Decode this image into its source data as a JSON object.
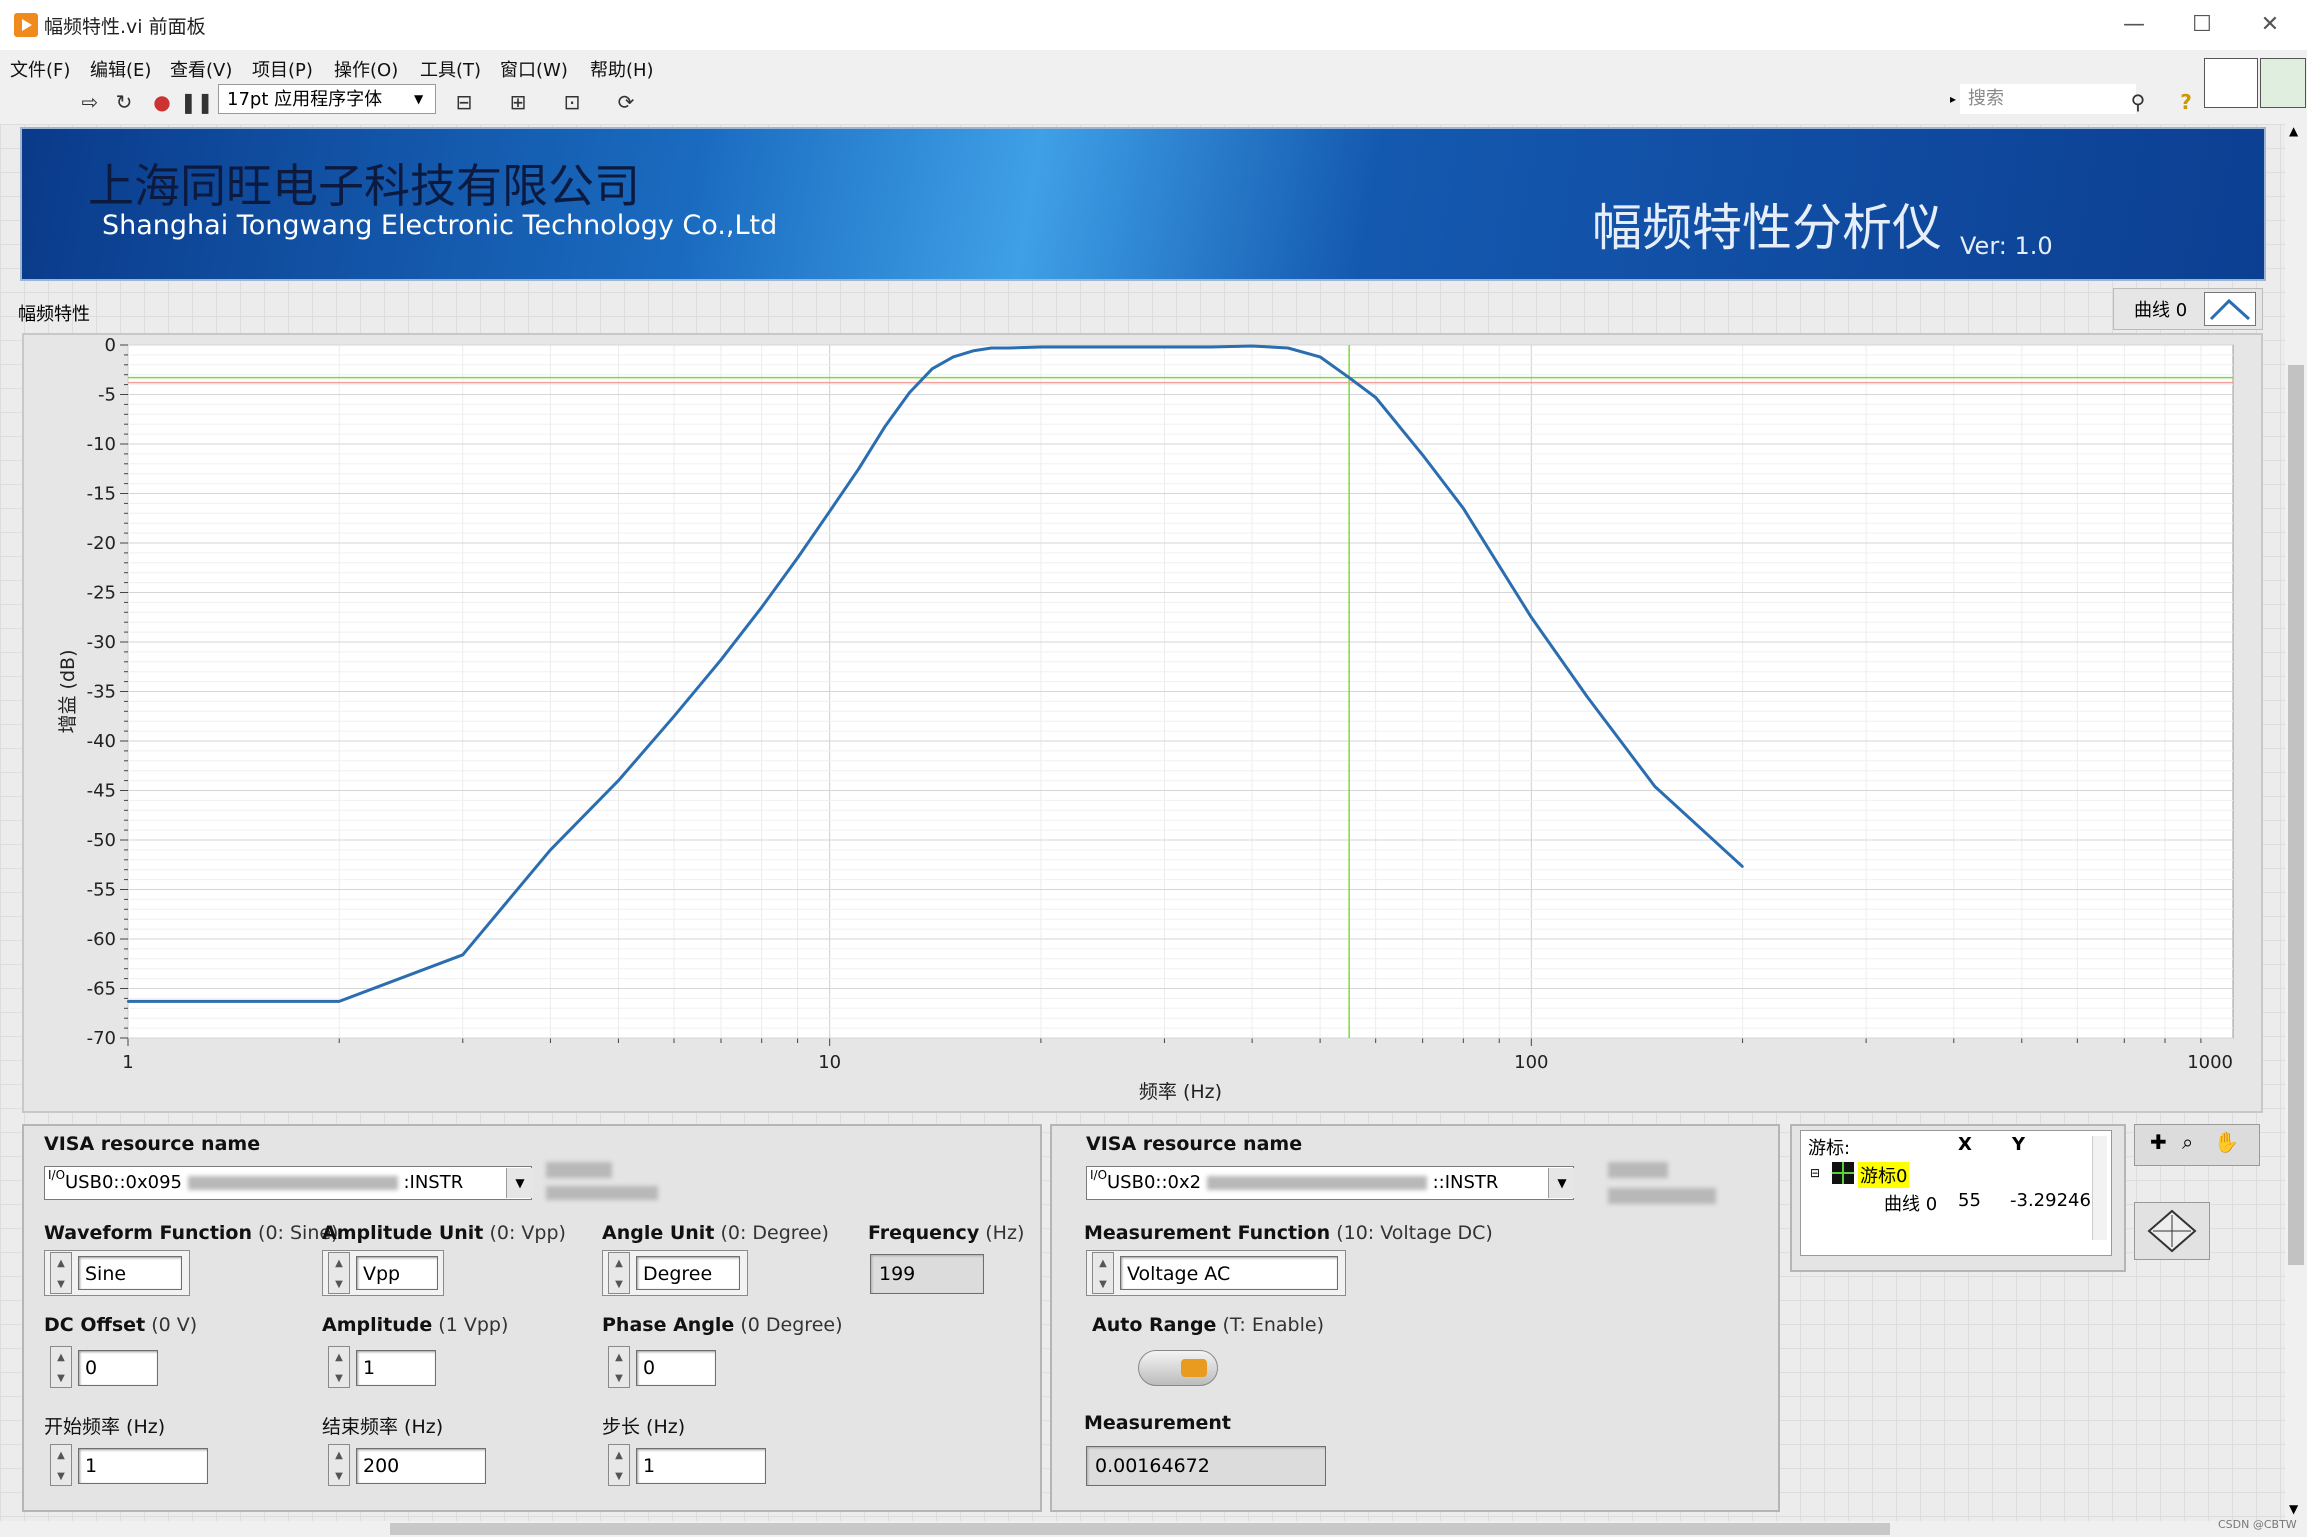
{
  "window": {
    "title": "幅频特性.vi 前面板",
    "minimize": "—",
    "maximize": "☐",
    "close": "✕"
  },
  "menu": [
    "文件(F)",
    "编辑(E)",
    "查看(V)",
    "项目(P)",
    "操作(O)",
    "工具(T)",
    "窗口(W)",
    "帮助(H)"
  ],
  "toolbar": {
    "font": "17pt 应用程序字体",
    "search_placeholder": "搜索"
  },
  "banner": {
    "company_cn": "上海同旺电子科技有限公司",
    "company_en": "Shanghai Tongwang Electronic Technology Co.,Ltd",
    "app_title": "幅频特性分析仪",
    "version": "Ver:  1.0"
  },
  "graph": {
    "label": "幅频特性",
    "legend": "曲线 0",
    "x_label": "频率 (Hz)",
    "y_label": "增益 (dB)",
    "x_ticks": [
      "1",
      "10",
      "100",
      "1000"
    ],
    "y_ticks": [
      "0",
      "-5",
      "-10",
      "-15",
      "-20",
      "-25",
      "-30",
      "-35",
      "-40",
      "-45",
      "-50",
      "-55",
      "-60",
      "-65",
      "-70"
    ],
    "colors": {
      "curve": "#2a6db0",
      "cursor": "#7bdc3a",
      "ref_line": "#f2a0a0"
    }
  },
  "chart_data": {
    "type": "line",
    "title": "幅频特性",
    "xlabel": "频率 (Hz)",
    "ylabel": "增益 (dB)",
    "xscale": "log",
    "xlim": [
      1,
      1000
    ],
    "ylim": [
      -70,
      0
    ],
    "grid": true,
    "series": [
      {
        "name": "曲线 0",
        "x": [
          1,
          2,
          3,
          4,
          5,
          6,
          7,
          8,
          9,
          10,
          11,
          12,
          13,
          14,
          15,
          16,
          17,
          18,
          20,
          25,
          30,
          35,
          40,
          45,
          50,
          55,
          60,
          70,
          80,
          100,
          120,
          150,
          200
        ],
        "y": [
          -66.3,
          -66.3,
          -61.6,
          -51.0,
          -44.0,
          -37.5,
          -31.8,
          -26.5,
          -21.5,
          -16.8,
          -12.5,
          -8.2,
          -4.8,
          -2.4,
          -1.2,
          -0.6,
          -0.3,
          -0.3,
          -0.2,
          -0.2,
          -0.2,
          -0.2,
          -0.1,
          -0.3,
          -1.2,
          -3.3,
          -5.3,
          -11.1,
          -16.5,
          -27.5,
          -35.5,
          -44.6,
          -52.7
        ]
      }
    ],
    "cursor": {
      "x": 55,
      "y": -3.29
    }
  },
  "gen": {
    "visa_label": "VISA resource name",
    "visa_value_start": "USB0::0x095",
    "visa_value_end": ":INSTR",
    "waveform_label": "Waveform Function",
    "waveform_hint": "(0: Sine)",
    "waveform_value": "Sine",
    "amp_unit_label": "Amplitude Unit",
    "amp_unit_hint": "(0: Vpp)",
    "amp_unit_value": "Vpp",
    "angle_unit_label": "Angle Unit",
    "angle_unit_hint": "(0: Degree)",
    "angle_unit_value": "Degree",
    "freq_label": "Frequency",
    "freq_hint": "(Hz)",
    "freq_value": "199",
    "dc_label": "DC Offset",
    "dc_hint": "(0 V)",
    "dc_value": "0",
    "amp_label": "Amplitude",
    "amp_hint": "(1 Vpp)",
    "amp_value": "1",
    "phase_label": "Phase Angle",
    "phase_hint": "(0 Degree)",
    "phase_value": "0",
    "start_label": "开始频率 (Hz)",
    "start_value": "1",
    "end_label": "结束频率 (Hz)",
    "end_value": "200",
    "step_label": "步长 (Hz)",
    "step_value": "1"
  },
  "meter": {
    "visa_label": "VISA resource name",
    "visa_value_start": "USB0::0x2",
    "visa_value_end": "::INSTR",
    "func_label": "Measurement Function",
    "func_hint": "(10: Voltage DC)",
    "func_value": "Voltage AC",
    "autorange_label": "Auto Range",
    "autorange_hint": "(T: Enable)",
    "measurement_label": "Measurement",
    "measurement_value": "0.00164672"
  },
  "cursor_legend": {
    "title": "游标:",
    "col_x": "X",
    "col_y": "Y",
    "cursor_name": "游标0",
    "plot_name": "曲线 0",
    "x_value": "55",
    "y_value": "-3.29246"
  },
  "watermark": "CSDN @CBTW"
}
